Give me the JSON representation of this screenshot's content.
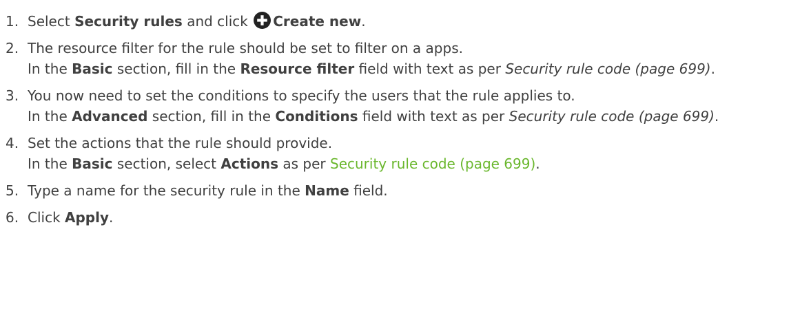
{
  "steps": [
    {
      "num": "1.",
      "l1_a": "Select ",
      "l1_b": "Security rules",
      "l1_c": " and click ",
      "icon": "plus-circle-icon",
      "l1_d": "Create new",
      "l1_e": "."
    },
    {
      "num": "2.",
      "l1": "The resource filter for the rule should be set to filter on a apps.",
      "l2_a": "In the ",
      "l2_b": "Basic",
      "l2_c": " section, fill in the ",
      "l2_d": "Resource filter",
      "l2_e": " field with text as per ",
      "l2_f": "Security rule code (page 699)",
      "l2_g": "."
    },
    {
      "num": "3.",
      "l1": "You now need to set the conditions to specify the users that the rule applies to.",
      "l2_a": "In the ",
      "l2_b": "Advanced",
      "l2_c": " section, fill in the ",
      "l2_d": "Conditions",
      "l2_e": " field with text as per ",
      "l2_f": "Security rule code (page 699)",
      "l2_g": "."
    },
    {
      "num": "4.",
      "l1": "Set the actions that the rule should provide.",
      "l2_a": "In the ",
      "l2_b": "Basic",
      "l2_c": " section, select ",
      "l2_d": "Actions",
      "l2_e": " as per ",
      "l2_link": "Security rule code (page 699)",
      "l2_g": "."
    },
    {
      "num": "5.",
      "l1_a": "Type a name for the security rule in the ",
      "l1_b": "Name",
      "l1_c": " field."
    },
    {
      "num": "6.",
      "l1_a": "Click ",
      "l1_b": "Apply",
      "l1_c": "."
    }
  ],
  "colors": {
    "text": "#404040",
    "link": "#6ab72d"
  }
}
